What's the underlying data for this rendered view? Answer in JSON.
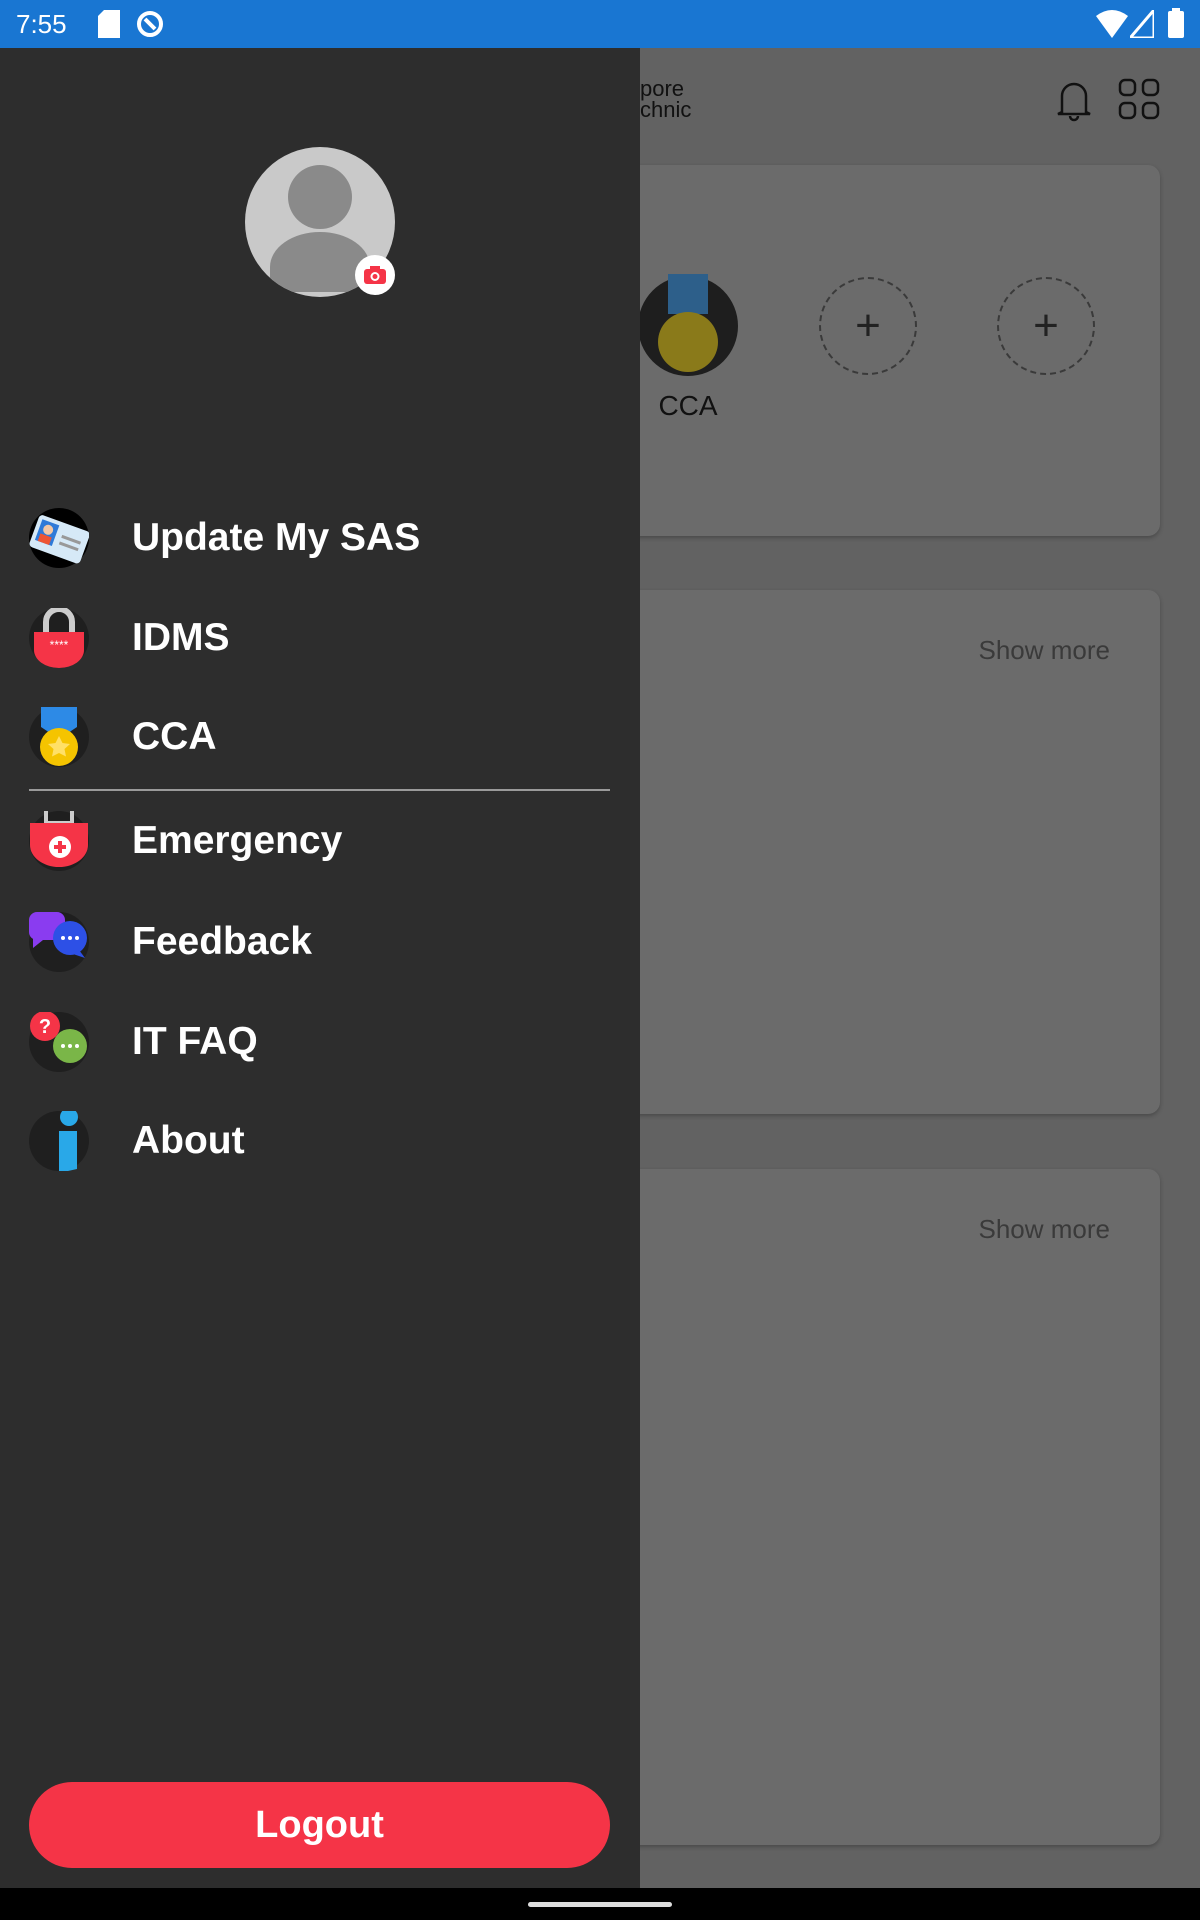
{
  "status_bar": {
    "time": "7:55",
    "color": "#1976D2",
    "icons": [
      "sd-card-icon",
      "sync-icon",
      "wifi-icon",
      "signal-icon",
      "battery-icon"
    ]
  },
  "background": {
    "logo_partial": [
      "pore",
      "chnic"
    ],
    "header_icons": [
      "bell-icon",
      "apps-grid-icon"
    ],
    "card1": {
      "shortcut_label": "CCA",
      "add_slots": [
        "+",
        "+"
      ]
    },
    "card2": {
      "show_more": "Show more"
    },
    "card3": {
      "show_more": "Show more"
    }
  },
  "drawer": {
    "avatar": {
      "icon": "person-icon",
      "badge_icon": "camera-icon"
    },
    "items": [
      {
        "label": "Update My SAS",
        "icon": "id-card-icon"
      },
      {
        "label": "IDMS",
        "icon": "lock-icon"
      },
      {
        "label": "CCA",
        "icon": "medal-icon"
      },
      {
        "label": "Emergency",
        "icon": "first-aid-icon"
      },
      {
        "label": "Feedback",
        "icon": "chat-bubbles-icon"
      },
      {
        "label": "IT FAQ",
        "icon": "faq-icon"
      },
      {
        "label": "About",
        "icon": "info-icon"
      }
    ],
    "logout_label": "Logout",
    "accent": "#F53447"
  }
}
